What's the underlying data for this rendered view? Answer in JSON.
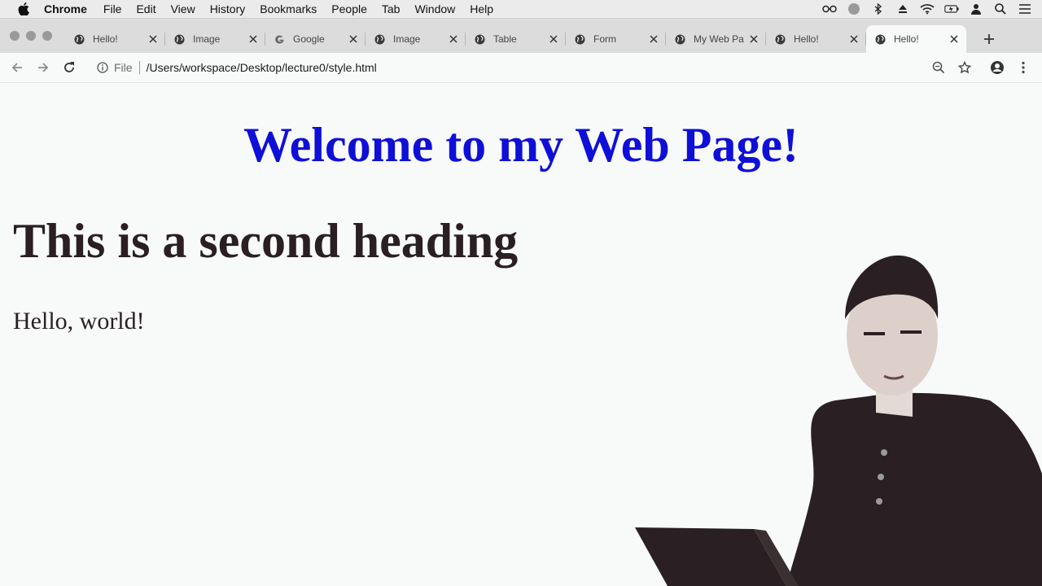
{
  "menubar": {
    "app": "Chrome",
    "items": [
      "File",
      "Edit",
      "View",
      "History",
      "Bookmarks",
      "People",
      "Tab",
      "Window",
      "Help"
    ]
  },
  "tabs": [
    {
      "title": "Hello!",
      "icon": "globe-icon"
    },
    {
      "title": "Image",
      "icon": "globe-icon"
    },
    {
      "title": "Google",
      "icon": "google-icon"
    },
    {
      "title": "Image",
      "icon": "globe-icon"
    },
    {
      "title": "Table",
      "icon": "globe-icon"
    },
    {
      "title": "Form",
      "icon": "globe-icon"
    },
    {
      "title": "My Web Pa",
      "icon": "globe-icon"
    },
    {
      "title": "Hello!",
      "icon": "globe-icon"
    },
    {
      "title": "Hello!",
      "icon": "globe-icon",
      "active": true
    }
  ],
  "address_bar": {
    "scheme_label": "File",
    "url": "/Users/workspace/Desktop/lecture0/style.html"
  },
  "page": {
    "heading1": "Welcome to my Web Page!",
    "heading2": "This is a second heading",
    "paragraph": "Hello, world!"
  },
  "colors": {
    "heading1": "#0f0fd8",
    "text": "#2a1f22",
    "background": "#f7faf9"
  }
}
